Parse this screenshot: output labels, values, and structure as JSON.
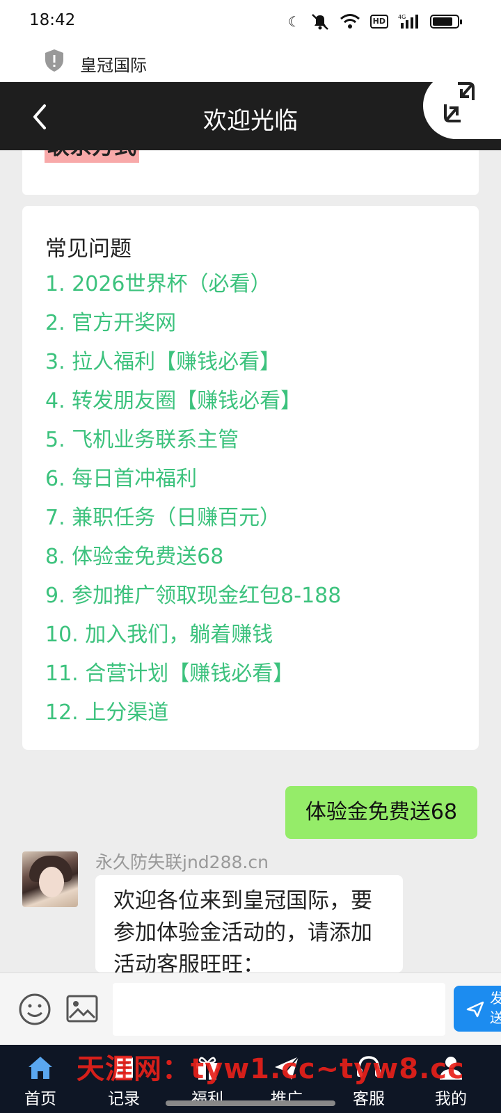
{
  "status_bar": {
    "time": "18:42",
    "hd": "HD",
    "network": "4G"
  },
  "url_bar": {
    "title": "皇冠国际"
  },
  "header": {
    "title": "欢迎光临"
  },
  "contact_card": {
    "text": "联系方式"
  },
  "faq": {
    "title": "常见问题",
    "items": [
      "1. 2026世界杯（必看）",
      "2. 官方开奖网",
      "3. 拉人福利【赚钱必看】",
      "4. 转发朋友圈【赚钱必看】",
      "5. 飞机业务联系主管",
      "6. 每日首冲福利",
      "7. 兼职任务（日赚百元）",
      "8. 体验金免费送68",
      "9. 参加推广领取现金红包8-188",
      "10. 加入我们，躺着赚钱",
      "11. 合营计划【赚钱必看】",
      "12. 上分渠道"
    ]
  },
  "chat": {
    "my_message": "体验金免费送68",
    "sender_name": "永久防失联jnd288.cn",
    "reply": "欢迎各位来到皇冠国际，要参加体验金活动的，请添加活动客服旺旺："
  },
  "input": {
    "placeholder": "",
    "send_label": "发送"
  },
  "tabs": [
    "首页",
    "记录",
    "福利",
    "推广",
    "客服",
    "我的"
  ],
  "watermark": "天涯网：tyw1.cc~tyw8.cc",
  "colors": {
    "link_green": "#3cc27d",
    "bubble_green": "#95ec69",
    "send_blue": "#1c8cf0",
    "header_dark": "#1e1e1e",
    "tab_bar": "#0e1625"
  }
}
